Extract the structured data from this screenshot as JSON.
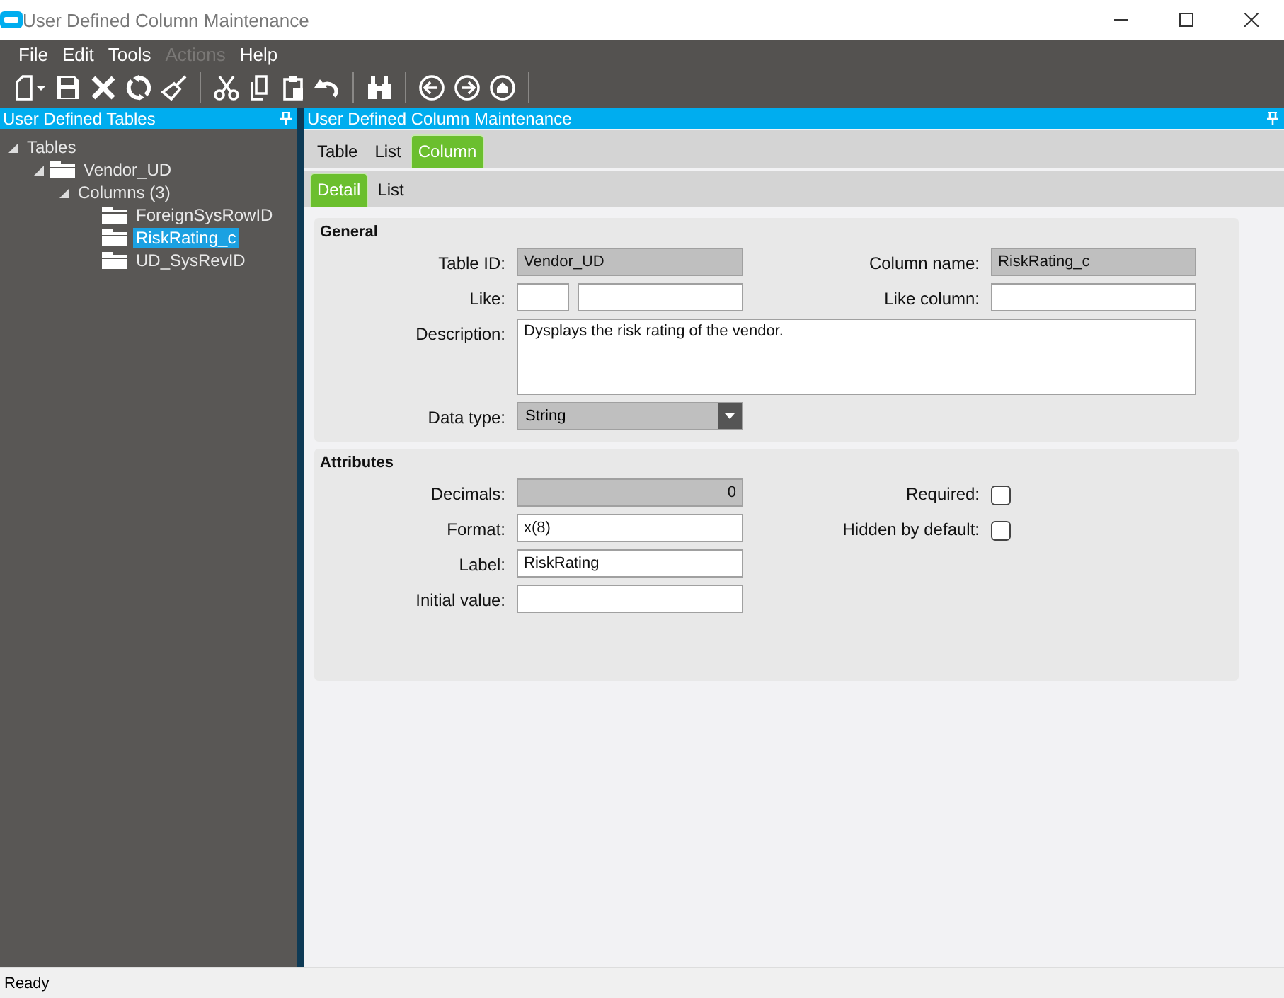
{
  "window": {
    "title": "User Defined Column Maintenance"
  },
  "menu": [
    {
      "label": "File",
      "disabled": false
    },
    {
      "label": "Edit",
      "disabled": false
    },
    {
      "label": "Tools",
      "disabled": false
    },
    {
      "label": "Actions",
      "disabled": true
    },
    {
      "label": "Help",
      "disabled": false
    }
  ],
  "sidebar": {
    "title": "User Defined Tables",
    "tree": [
      {
        "label": "Tables",
        "expanded": true,
        "selected": false,
        "children": [
          {
            "label": "Vendor_UD",
            "kind": "folder",
            "expanded": true,
            "selected": false,
            "children": [
              {
                "label": "Columns (3)",
                "expanded": true,
                "selected": false,
                "children": [
                  {
                    "label": "ForeignSysRowID",
                    "kind": "folder",
                    "selected": false
                  },
                  {
                    "label": "RiskRating_c",
                    "kind": "folder",
                    "selected": true
                  },
                  {
                    "label": "UD_SysRevID",
                    "kind": "folder",
                    "selected": false
                  }
                ]
              }
            ]
          }
        ]
      }
    ]
  },
  "main": {
    "title": "User Defined Column Maintenance",
    "tabs": [
      {
        "label": "Table",
        "selected": false
      },
      {
        "label": "List",
        "selected": false
      },
      {
        "label": "Column",
        "selected": true
      }
    ],
    "subtabs": [
      {
        "label": "Detail",
        "selected": true
      },
      {
        "label": "List",
        "selected": false
      }
    ],
    "sections": [
      {
        "title": "General",
        "rows": [
          {
            "left": {
              "label": "Table ID:",
              "kind": "readonly",
              "value": "Vendor_UD"
            },
            "right": {
              "label": "Column name:",
              "kind": "readonly",
              "value": "RiskRating_c"
            }
          },
          {
            "left": {
              "label": "Like:",
              "kind": "pair"
            },
            "right": {
              "label": "Like column:",
              "kind": "text"
            }
          },
          {
            "left": {
              "label": "Description:",
              "kind": "textarea",
              "value": "Dysplays the risk rating of the vendor."
            }
          },
          {
            "left": {
              "label": "Data type:",
              "kind": "dropdown",
              "value": "String"
            }
          }
        ]
      },
      {
        "title": "Attributes",
        "rows": [
          {
            "left": {
              "label": "Decimals:",
              "kind": "number",
              "value": "0"
            },
            "right": {
              "label": "Required:",
              "kind": "checkbox",
              "checked": false
            }
          },
          {
            "left": {
              "label": "Format:",
              "kind": "text",
              "value": "x(8)"
            },
            "right": {
              "label": "Hidden by default:",
              "kind": "checkbox",
              "checked": false
            }
          },
          {
            "left": {
              "label": "Label:",
              "kind": "text",
              "value": "RiskRating"
            }
          },
          {
            "left": {
              "label": "Initial value:",
              "kind": "text"
            }
          }
        ]
      }
    ]
  },
  "status_bar": "Ready"
}
